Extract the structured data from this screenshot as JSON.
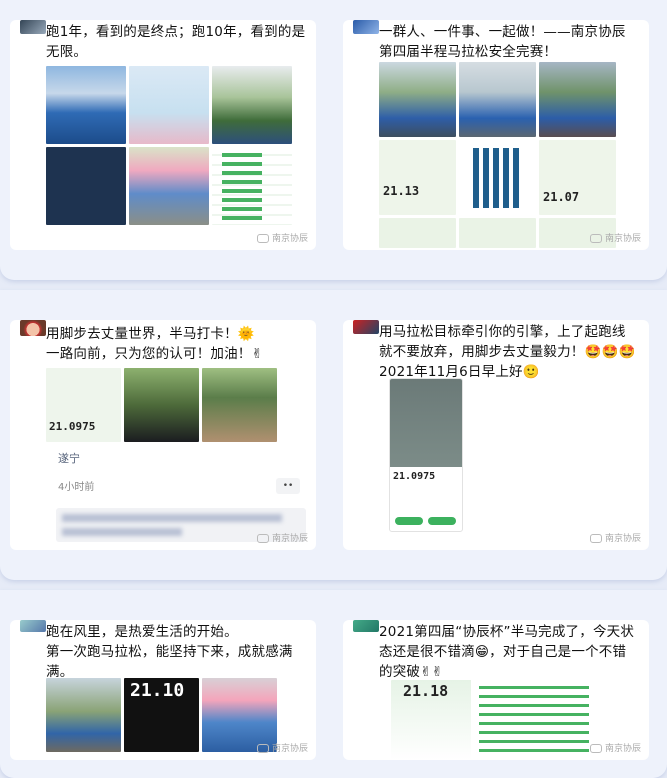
{
  "watermark": "南京协辰",
  "posts": [
    {
      "text": "跑1年，看到的是终点；跑10年，看到的是无限。"
    },
    {
      "text": "一群人、一件事、一起做！——南京协辰第四届半程马拉松安全完赛！",
      "stat1": "21.13",
      "stat2": "21.07"
    },
    {
      "text": "用脚步去丈量世界，半马打卡！🌞\n一路向前，只为您的认可！加油！✌",
      "stat": "21.0975",
      "location": "遂宁",
      "time": "4小时前",
      "more": "••"
    },
    {
      "text": "用马拉松目标牵引你的引擎，上了起跑线就不要放弃，用脚步去丈量毅力！🤩🤩🤩\n2021年11月6日早上好🙂",
      "stat": "21.0975"
    },
    {
      "text": "跑在风里，是热爱生活的开始。\n第一次跑马拉松，能坚持下来，成就感满满。",
      "stat": "21.10"
    },
    {
      "text": "2021第四届“协辰杯”半马完成了，今天状态还是很不错滴😁，对于自己是一个不错的突破✌✌",
      "stat": "21.18"
    }
  ]
}
